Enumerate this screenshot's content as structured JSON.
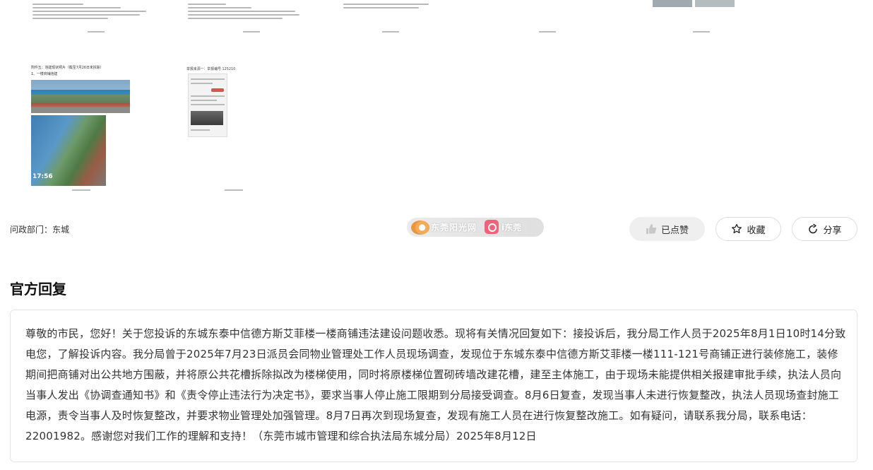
{
  "attachments": {
    "photo_sheet": {
      "title": "附件五：违建现状照片（截至7月26日未拆除）",
      "subtitle": "1、一楼商铺违建",
      "photo_time": "17:56"
    },
    "phone_sheet": {
      "header": "举报来源一：举报编号 125210"
    }
  },
  "meta": {
    "dept_label": "问政部门：",
    "dept_value": "东城"
  },
  "watermark": {
    "text1": "东莞阳光网",
    "text2": "i东莞"
  },
  "actions": {
    "like_label": "已点赞",
    "favorite_label": "收藏",
    "share_label": "分享"
  },
  "reply": {
    "section_title": "官方回复",
    "body": "尊敬的市民，您好！关于您投诉的东城东泰中信德方斯艾菲楼一楼商铺违法建设问题收悉。现将有关情况回复如下：接投诉后，我分局工作人员于2025年8月1日10时14分致电您，了解投诉内容。我分局曾于2025年7月23日派员会同物业管理处工作人员现场调查，发现位于东城东泰中信德方斯艾菲楼一楼111-121号商铺正进行装修施工，装修期间把商铺对出公共地方围蔽，并将原公共花槽拆除拟改为楼梯使用，同时将原楼梯位置砌砖墙改建花槽，建至主体施工，由于现场未能提供相关报建审批手续，执法人员向当事人发出《协调查通知书》和《责令停止违法行为决定书》，要求当事人停止施工限期到分局接受调查。8月6日复查，发现当事人未进行恢复整改，执法人员现场查封施工电源，责令当事人及时恢复整改，并要求物业管理处加强管理。8月7日再次到现场复查，发现有施工人员在进行恢复整改施工。如有疑问，请联系我分局，联系电话：22001982。感谢您对我们工作的理解和支持！（东莞市城市管理和综合执法局东城分局）2025年8月12日"
  },
  "colors": {
    "like_bg": "#efefef",
    "border": "#dedede",
    "title": "#111111"
  }
}
